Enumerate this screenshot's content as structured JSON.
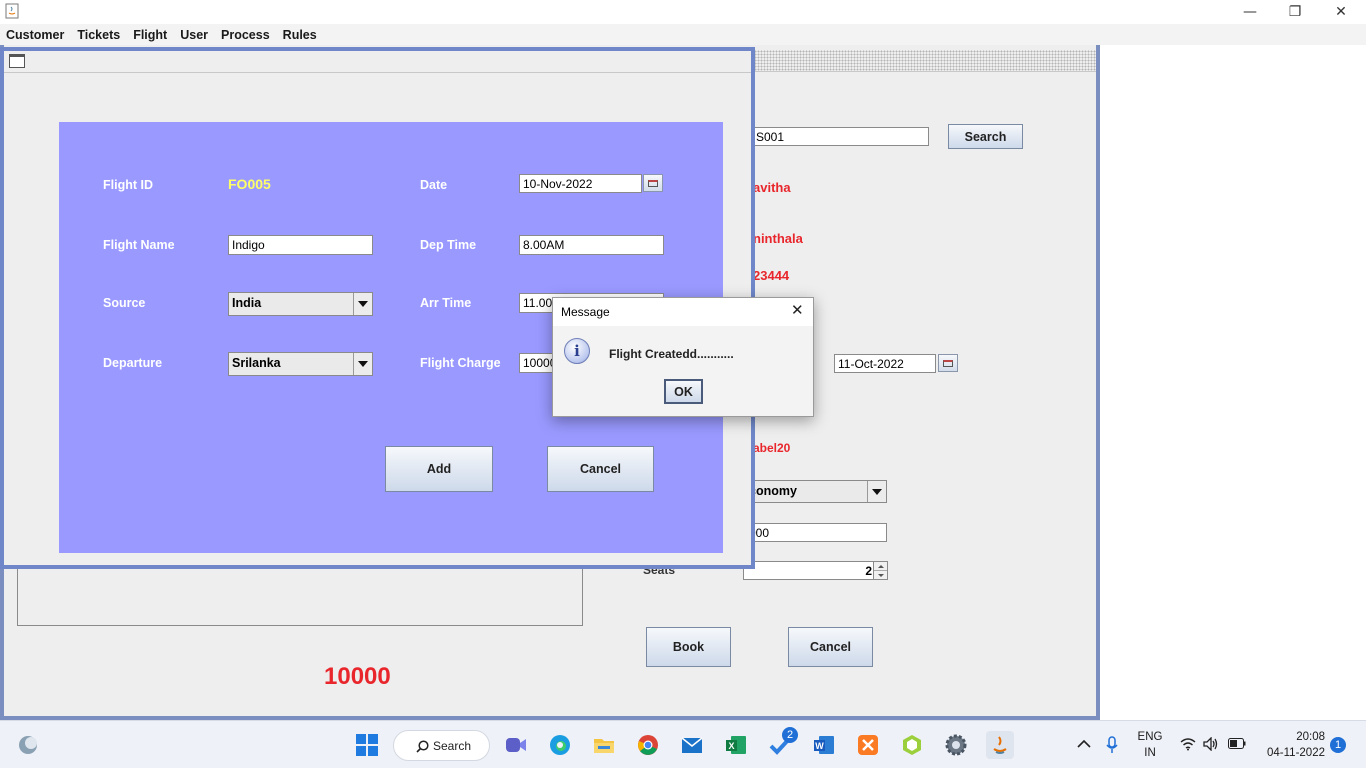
{
  "menubar": {
    "items": [
      "Customer",
      "Tickets",
      "Flight",
      "User",
      "Process",
      "Rules"
    ]
  },
  "window_controls": {
    "minimize": "—",
    "restore": "❐",
    "close": "✕"
  },
  "background_form": {
    "customer_id_value": "S001",
    "search_label": "Search",
    "firstname_value": "avitha",
    "lastname_value": "ninthala",
    "contact_value": "23444",
    "date_value": "11-Oct-2022",
    "flight_label_value": "abel20",
    "class_value": "conomy",
    "price_value": "000",
    "seats_label": "Seats",
    "seats_value": "2",
    "book_label": "Book",
    "cancel_label": "Cancel",
    "total_value": "10000"
  },
  "flight_form": {
    "flight_id_label": "Flight ID",
    "flight_id_value": "FO005",
    "flight_name_label": "Flight Name",
    "flight_name_value": "Indigo",
    "source_label": "Source",
    "source_value": "India",
    "departure_label": "Departure",
    "departure_value": "Srilanka",
    "date_label": "Date",
    "date_value": "10-Nov-2022",
    "dep_time_label": "Dep Time",
    "dep_time_value": "8.00AM",
    "arr_time_label": "Arr Time",
    "arr_time_value": "11.00",
    "flight_charge_label": "Flight Charge",
    "flight_charge_value": "10000",
    "add_label": "Add",
    "cancel_label": "Cancel"
  },
  "dialog": {
    "title": "Message",
    "message": "Flight Createdd...........",
    "ok_label": "OK"
  },
  "taskbar": {
    "search_label": "Search",
    "todo_badge": "2",
    "lang_line1": "ENG",
    "lang_line2": "IN",
    "time": "20:08",
    "date": "04-11-2022",
    "notification_count": "1",
    "icons": [
      "copilot-icon",
      "windows-start-icon",
      "search-icon",
      "meet-icon",
      "edge-icon",
      "file-explorer-icon",
      "chrome-icon",
      "mail-icon",
      "excel-icon",
      "todo-icon",
      "word-icon",
      "xampp-icon",
      "box-icon",
      "settings-icon",
      "java-icon"
    ]
  },
  "colors": {
    "panel": "#9999ff",
    "accent_red": "#e8262c",
    "flight_id_yellow": "#ffff66",
    "frame_blue": "#6f87c9"
  }
}
